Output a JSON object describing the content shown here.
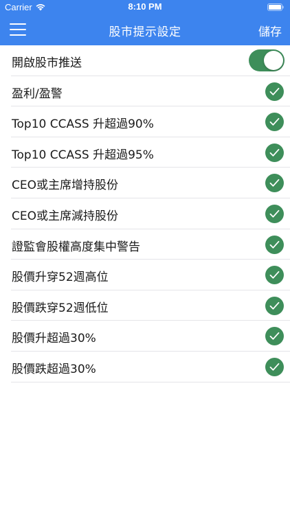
{
  "status_bar": {
    "carrier": "Carrier",
    "time": "8:10 PM"
  },
  "nav": {
    "title": "股市提示設定",
    "save_label": "儲存",
    "menu_icon": "hamburger-menu-icon",
    "background_color": "#3d84ee"
  },
  "settings": {
    "push_toggle": {
      "label": "開啟股市推送",
      "on": true
    },
    "items": [
      {
        "label": "盈利/盈警",
        "checked": true
      },
      {
        "label": "Top10 CCASS 升超過90%",
        "checked": true
      },
      {
        "label": "Top10 CCASS 升超過95%",
        "checked": true
      },
      {
        "label": "CEO或主席增持股份",
        "checked": true
      },
      {
        "label": "CEO或主席減持股份",
        "checked": true
      },
      {
        "label": "證監會股權高度集中警告",
        "checked": true
      },
      {
        "label": "股價升穿52週高位",
        "checked": true
      },
      {
        "label": "股價跌穿52週低位",
        "checked": true
      },
      {
        "label": "股價升超過30%",
        "checked": true
      },
      {
        "label": "股價跌超過30%",
        "checked": true
      }
    ],
    "accent_color": "#3e8e5a"
  }
}
